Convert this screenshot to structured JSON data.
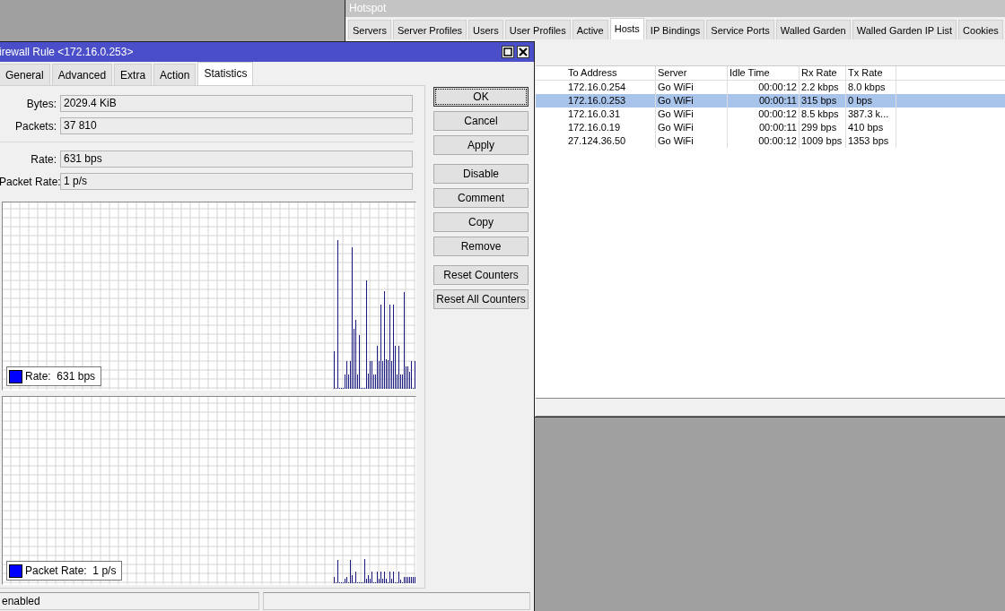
{
  "hotspot_window": {
    "title": "Hotspot",
    "tabs": [
      {
        "label": "Servers",
        "selected": false
      },
      {
        "label": "Server Profiles",
        "selected": false
      },
      {
        "label": "Users",
        "selected": false
      },
      {
        "label": "User Profiles",
        "selected": false
      },
      {
        "label": "Active",
        "selected": false
      },
      {
        "label": "Hosts",
        "selected": true
      },
      {
        "label": "IP Bindings",
        "selected": false
      },
      {
        "label": "Service Ports",
        "selected": false
      },
      {
        "label": "Walled Garden",
        "selected": false
      },
      {
        "label": "Walled Garden IP List",
        "selected": false
      },
      {
        "label": "Cookies",
        "selected": false
      }
    ],
    "table": {
      "columns": [
        "To Address",
        "Server",
        "Idle Time",
        "Rx Rate",
        "Tx Rate"
      ],
      "rows": [
        {
          "cells": [
            "172.16.0.254",
            "Go WiFi",
            "00:00:12",
            "2.2 kbps",
            "8.0 kbps"
          ],
          "selected": false
        },
        {
          "cells": [
            "172.16.0.253",
            "Go WiFi",
            "00:00:11",
            "315 bps",
            "0 bps"
          ],
          "selected": true
        },
        {
          "cells": [
            "172.16.0.31",
            "Go WiFi",
            "00:00:12",
            "8.5 kbps",
            "387.3 k..."
          ],
          "selected": false
        },
        {
          "cells": [
            "172.16.0.19",
            "Go WiFi",
            "00:00:11",
            "299 bps",
            "410 bps"
          ],
          "selected": false
        },
        {
          "cells": [
            "27.124.36.50",
            "Go WiFi",
            "00:00:12",
            "1009 bps",
            "1353 bps"
          ],
          "selected": false
        }
      ]
    }
  },
  "firewall_window": {
    "title": "irewall Rule <172.16.0.253>",
    "tabs": [
      {
        "label": "General",
        "selected": false
      },
      {
        "label": "Advanced",
        "selected": false
      },
      {
        "label": "Extra",
        "selected": false
      },
      {
        "label": "Action",
        "selected": false
      },
      {
        "label": "Statistics",
        "selected": true
      }
    ],
    "field_groups": [
      [
        {
          "label": "Bytes:",
          "value": "2029.4 KiB"
        },
        {
          "label": "Packets:",
          "value": "37 810"
        }
      ],
      [
        {
          "label": "Rate:",
          "value": "631 bps"
        },
        {
          "label": "Packet Rate:",
          "value": "1 p/s"
        }
      ]
    ],
    "charts": [
      {
        "legend": "Rate:  631 bps"
      },
      {
        "legend": "Packet Rate:  1 p/s"
      }
    ],
    "button_groups": [
      [
        {
          "label": "OK",
          "focused": true
        },
        {
          "label": "Cancel",
          "focused": false
        },
        {
          "label": "Apply",
          "focused": false
        }
      ],
      [
        {
          "label": "Disable",
          "focused": false
        },
        {
          "label": "Comment",
          "focused": false
        },
        {
          "label": "Copy",
          "focused": false
        },
        {
          "label": "Remove",
          "focused": false
        }
      ],
      [
        {
          "label": "Reset Counters",
          "focused": false
        },
        {
          "label": "Reset All Counters",
          "focused": false
        }
      ]
    ],
    "status": "enabled"
  }
}
